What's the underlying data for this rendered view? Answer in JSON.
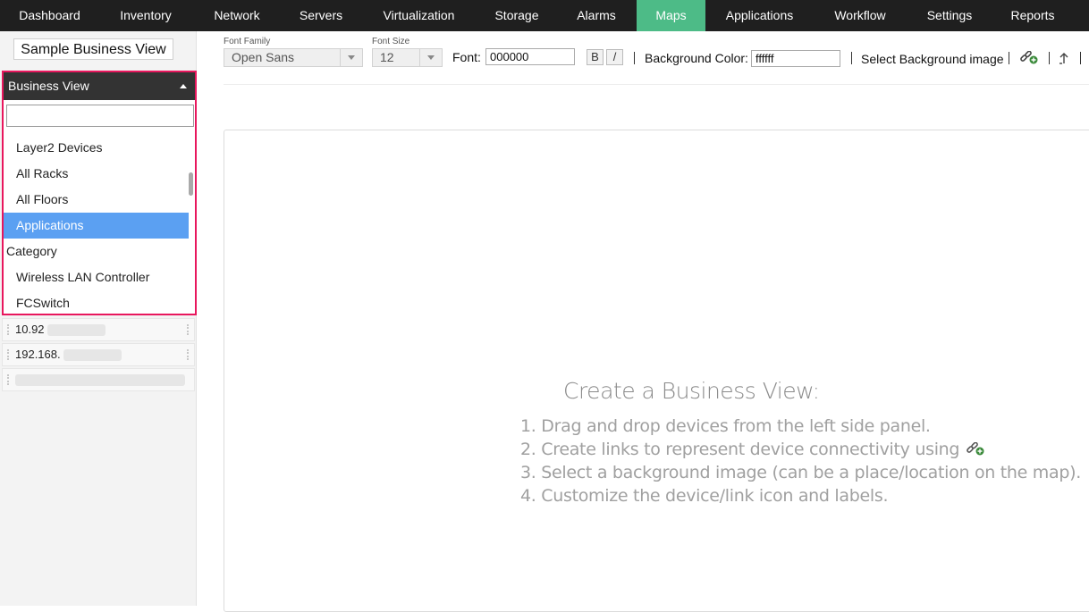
{
  "nav": {
    "items": [
      {
        "label": "Dashboard"
      },
      {
        "label": "Inventory"
      },
      {
        "label": "Network"
      },
      {
        "label": "Servers"
      },
      {
        "label": "Virtualization"
      },
      {
        "label": "Storage"
      },
      {
        "label": "Alarms"
      },
      {
        "label": "Maps"
      },
      {
        "label": "Applications"
      },
      {
        "label": "Workflow"
      },
      {
        "label": "Settings"
      },
      {
        "label": "Reports"
      }
    ],
    "active": "Maps",
    "active_color": "#4dbb87"
  },
  "left_panel": {
    "business_view_name": "Sample Business View",
    "dropdown": {
      "header": "Business View",
      "search_value": "",
      "options": [
        {
          "label": "Layer2 Devices",
          "kind": "child"
        },
        {
          "label": "All Racks",
          "kind": "child"
        },
        {
          "label": "All Floors",
          "kind": "child"
        },
        {
          "label": "Applications",
          "kind": "child",
          "selected": true
        },
        {
          "label": "Category",
          "kind": "group"
        },
        {
          "label": "Wireless LAN Controller",
          "kind": "child"
        },
        {
          "label": "FCSwitch",
          "kind": "child"
        }
      ],
      "highlight_color": "#e8175d",
      "selected_color": "#5ba0f2"
    },
    "devices": [
      {
        "label": "10.92"
      },
      {
        "label": "192.168."
      },
      {
        "label": ""
      }
    ]
  },
  "toolbar": {
    "font_family_label": "Font Family",
    "font_family_value": "Open Sans",
    "font_size_label": "Font Size",
    "font_size_value": "12",
    "font_label": "Font:",
    "font_color_value": "000000",
    "bold_label": "B",
    "italic_label": "/",
    "bg_color_label": "Background Color:",
    "bg_color_value": "ffffff",
    "bg_image_label": "Select Background image"
  },
  "canvas": {
    "title": "Create a Business View:",
    "steps": [
      "1. Drag and drop devices from the left side panel.",
      "2. Create links to represent device connectivity using",
      "3. Select a background image (can be a place/location on the map).",
      "4. Customize the device/link icon and labels."
    ]
  }
}
